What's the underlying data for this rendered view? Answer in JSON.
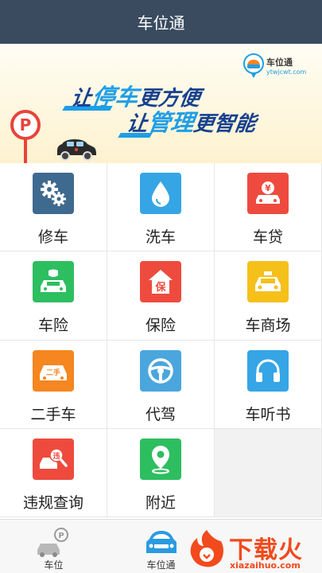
{
  "header": {
    "title": "车位通"
  },
  "banner": {
    "line1_a": "让",
    "line1_b": "停车",
    "line1_c": "更方便",
    "line2_a": "让",
    "line2_b": "管理",
    "line2_c": "更智能",
    "brand_name": "车位通",
    "brand_url": "ytwjcwt.com",
    "parking_sign": "P"
  },
  "grid": {
    "items": [
      {
        "label": "修车",
        "icon": "gears-icon",
        "color": "#3f6a8f"
      },
      {
        "label": "洗车",
        "icon": "water-drop-icon",
        "color": "#35a5e5"
      },
      {
        "label": "车贷",
        "icon": "car-loan-icon",
        "color": "#ee4b3e"
      },
      {
        "label": "车险",
        "icon": "car-insurance-icon",
        "color": "#2dbe60"
      },
      {
        "label": "保险",
        "icon": "insurance-house-icon",
        "color": "#ee4b3e"
      },
      {
        "label": "车商场",
        "icon": "taxi-icon",
        "color": "#f6c01b"
      },
      {
        "label": "二手车",
        "icon": "used-car-icon",
        "color": "#f58620"
      },
      {
        "label": "代驾",
        "icon": "steering-wheel-icon",
        "color": "#4aa6dc"
      },
      {
        "label": "车听书",
        "icon": "headphones-icon",
        "color": "#35a5e5"
      },
      {
        "label": "违规查询",
        "icon": "violation-search-icon",
        "color": "#ee4b3e"
      },
      {
        "label": "附近",
        "icon": "location-pin-icon",
        "color": "#2dbe60"
      }
    ],
    "tile_text": {
      "loan": "¥",
      "insurance": "保",
      "used": "二手",
      "violation": "违"
    }
  },
  "tabbar": {
    "tabs": [
      {
        "label": "车位",
        "icon": "parking-car-icon"
      },
      {
        "label": "车位通",
        "icon": "car-front-icon"
      }
    ]
  },
  "watermark": {
    "text": "下载火",
    "url": "xiazaihuo.com"
  },
  "colors": {
    "header": "#3a4b60",
    "banner_blue": "#17418e",
    "highlight": "#1f9ee6",
    "watermark": "#f24a1c"
  }
}
